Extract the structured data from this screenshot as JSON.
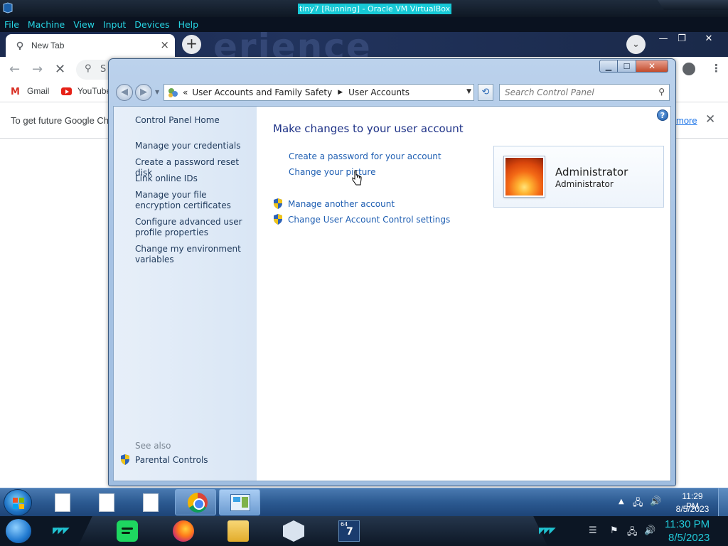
{
  "host": {
    "window_title": "tiny7 [Running] - Oracle VM VirtualBox",
    "menu": [
      "File",
      "Machine",
      "View",
      "Input",
      "Devices",
      "Help"
    ],
    "clock": {
      "time": "11:30 PM",
      "date": "8/5/2023"
    },
    "accent_color": "#21c9d8"
  },
  "chrome": {
    "tab_title": "New Tab",
    "omnibox_text": "S",
    "bookmarks": [
      "Gmail",
      "YouTube"
    ],
    "infobar_text": "To get future Google Ch",
    "infobar_link": "more"
  },
  "control_panel": {
    "breadcrumb": [
      "User Accounts and Family Safety",
      "User Accounts"
    ],
    "search_placeholder": "Search Control Panel",
    "sidebar": {
      "home": "Control Panel Home",
      "items": [
        "Manage your credentials",
        "Create a password reset disk",
        "Link online IDs",
        "Manage your file encryption certificates",
        "Configure advanced user profile properties",
        "Change my environment variables"
      ],
      "see_also_label": "See also",
      "see_also": [
        "Parental Controls"
      ]
    },
    "main": {
      "title": "Make changes to your user account",
      "links": [
        "Create a password for your account",
        "Change your picture"
      ],
      "shield_links": [
        "Manage another account",
        "Change User Account Control settings"
      ]
    },
    "user": {
      "name": "Administrator",
      "role": "Administrator"
    }
  },
  "guest_taskbar": {
    "clock": {
      "time": "11:29 PM",
      "date": "8/5/2023"
    }
  }
}
